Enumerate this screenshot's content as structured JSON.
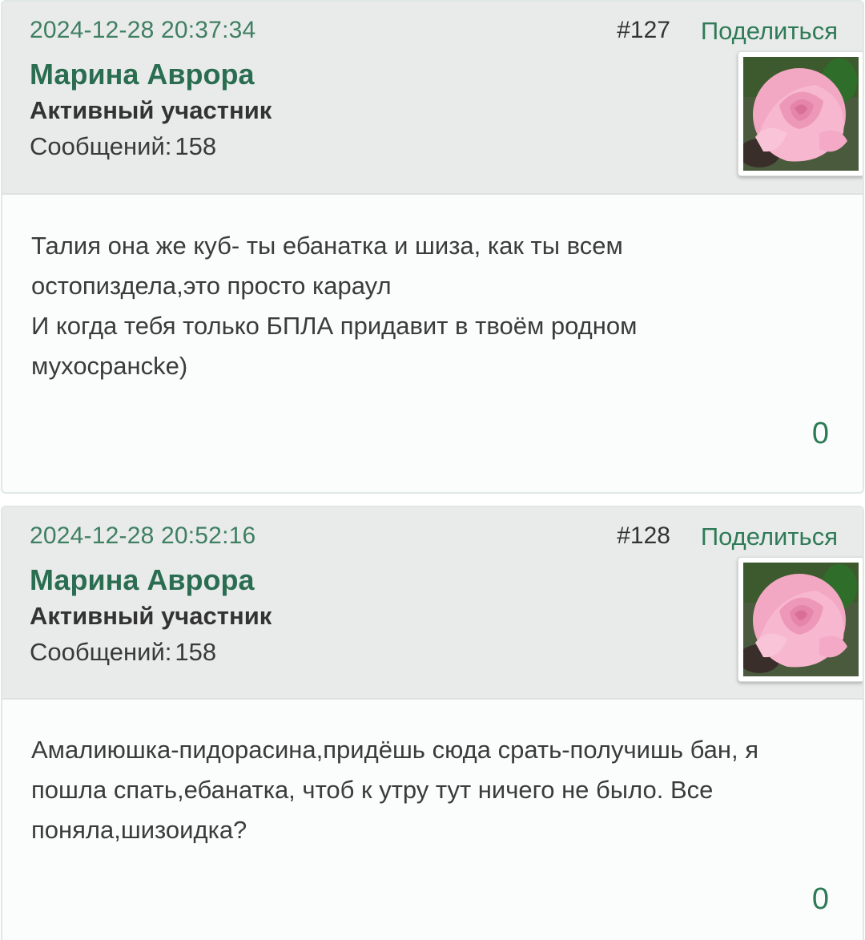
{
  "posts": [
    {
      "timestamp": "2024-12-28 20:37:34",
      "number": "#127",
      "share_label": "Поделиться",
      "author": "Марина Аврора",
      "role": "Активный участник",
      "messages_label": "Сообщений:",
      "messages_count": "158",
      "avatar_icon": "rose-avatar",
      "body_lines": [
        "Талия она же куб- ты ебанатка и шиза, как ты всем",
        "остопиздела,это просто караул",
        "И когда тебя только БПЛА придавит в твоём родном",
        "мухосрансke)"
      ],
      "likes": "0"
    },
    {
      "timestamp": "2024-12-28 20:52:16",
      "number": "#128",
      "share_label": "Поделиться",
      "author": "Марина Аврора",
      "role": "Активный участник",
      "messages_label": "Сообщений:",
      "messages_count": "158",
      "avatar_icon": "rose-avatar",
      "body_lines": [
        "Амалиюшка-пидорасина,придёшь сюда срать-получишь бан, я",
        "пошла спать,ебанатка, чтоб к утру тут ничего не было. Все",
        "поняла,шизоидка?"
      ],
      "likes": "0"
    }
  ],
  "colors": {
    "accent": "#2f7b57",
    "header_bg": "#e9ebea",
    "body_bg": "#fbfdfc"
  }
}
